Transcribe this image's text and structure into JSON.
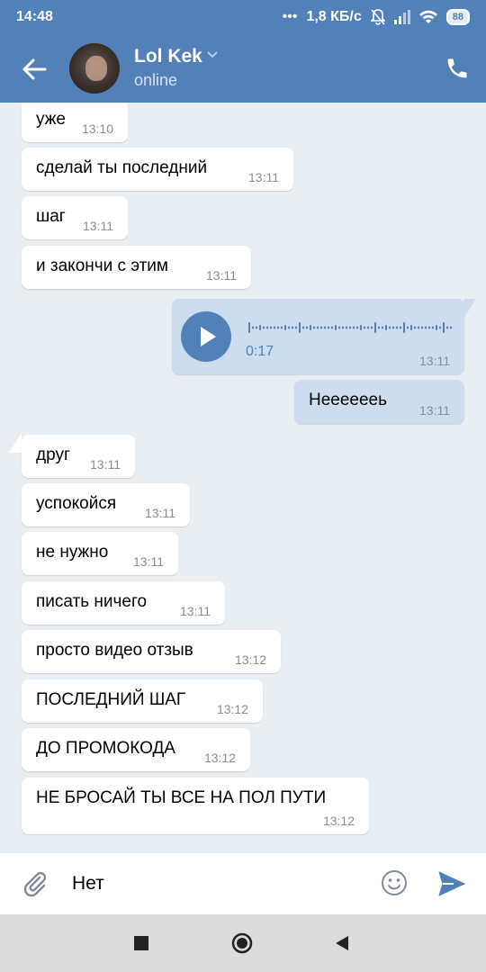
{
  "status_bar": {
    "time": "14:48",
    "speed": "1,8 КБ/с",
    "battery": "88"
  },
  "header": {
    "contact_name": "Lol Kek",
    "contact_status": "online"
  },
  "voice_message": {
    "duration": "0:17",
    "time": "13:11"
  },
  "messages": [
    {
      "text": "уже",
      "time": "13:10",
      "direction": "in"
    },
    {
      "text": "сделай ты последний",
      "time": "13:11",
      "direction": "in"
    },
    {
      "text": "шаг",
      "time": "13:11",
      "direction": "in"
    },
    {
      "text": "и закончи с этим",
      "time": "13:11",
      "direction": "in"
    },
    {
      "text": "Нееееееь",
      "time": "13:11",
      "direction": "out"
    },
    {
      "text": "друг",
      "time": "13:11",
      "direction": "in"
    },
    {
      "text": "успокойся",
      "time": "13:11",
      "direction": "in"
    },
    {
      "text": "не нужно",
      "time": "13:11",
      "direction": "in"
    },
    {
      "text": "писать ничего",
      "time": "13:11",
      "direction": "in"
    },
    {
      "text": "просто видео отзыв",
      "time": "13:12",
      "direction": "in"
    },
    {
      "text": "ПОСЛЕДНИЙ ШАГ",
      "time": "13:12",
      "direction": "in"
    },
    {
      "text": "ДО ПРОМОКОДА",
      "time": "13:12",
      "direction": "in"
    },
    {
      "text": "НЕ БРОСАЙ ТЫ ВСЕ НА ПОЛ ПУТИ",
      "time": "13:12",
      "direction": "in"
    }
  ],
  "composer": {
    "text": "Нет"
  },
  "colors": {
    "header": "#5181b8",
    "chat_background": "#e9eef3",
    "incoming_bubble": "#ffffff",
    "outgoing_bubble": "#cddcef",
    "accent": "#5181b8"
  }
}
